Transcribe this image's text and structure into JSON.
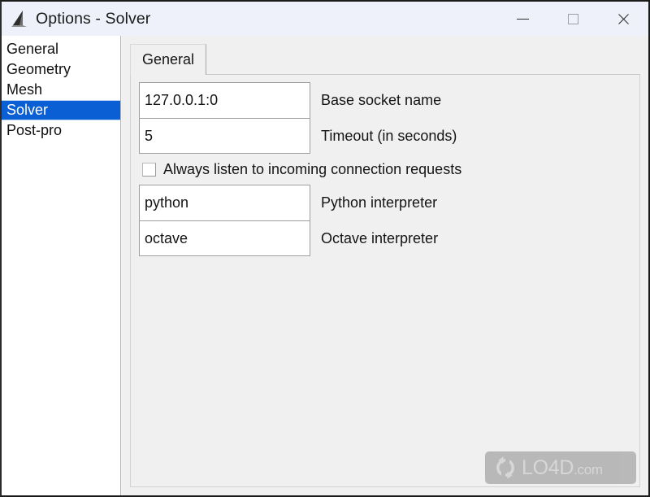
{
  "window": {
    "title": "Options - Solver",
    "icon": "gmsh-triangle-icon",
    "controls": {
      "minimize": "minimize-icon",
      "maximize": "maximize-icon",
      "close": "close-icon"
    },
    "colors": {
      "titlebar_bg": "#eef1fa",
      "selection_blue": "#0a5fd4",
      "panel_bg": "#f0f0f0",
      "field_bg": "#ffffff"
    }
  },
  "sidebar": {
    "items": [
      {
        "label": "General",
        "selected": false
      },
      {
        "label": "Geometry",
        "selected": false
      },
      {
        "label": "Mesh",
        "selected": false
      },
      {
        "label": "Solver",
        "selected": true
      },
      {
        "label": "Post-pro",
        "selected": false
      }
    ]
  },
  "tabs": [
    {
      "label": "General",
      "active": true
    }
  ],
  "form": {
    "fields": [
      {
        "value": "127.0.0.1:0",
        "label": "Base socket name"
      },
      {
        "value": "5",
        "label": "Timeout (in seconds)"
      },
      {
        "value": "python",
        "label": "Python interpreter"
      },
      {
        "value": "octave",
        "label": "Octave interpreter"
      }
    ],
    "checkbox": {
      "label": "Always listen to incoming connection requests",
      "checked": false
    }
  },
  "watermark": {
    "text": "LO4D",
    "suffix": ".com",
    "logo": "refresh-circle-icon"
  }
}
